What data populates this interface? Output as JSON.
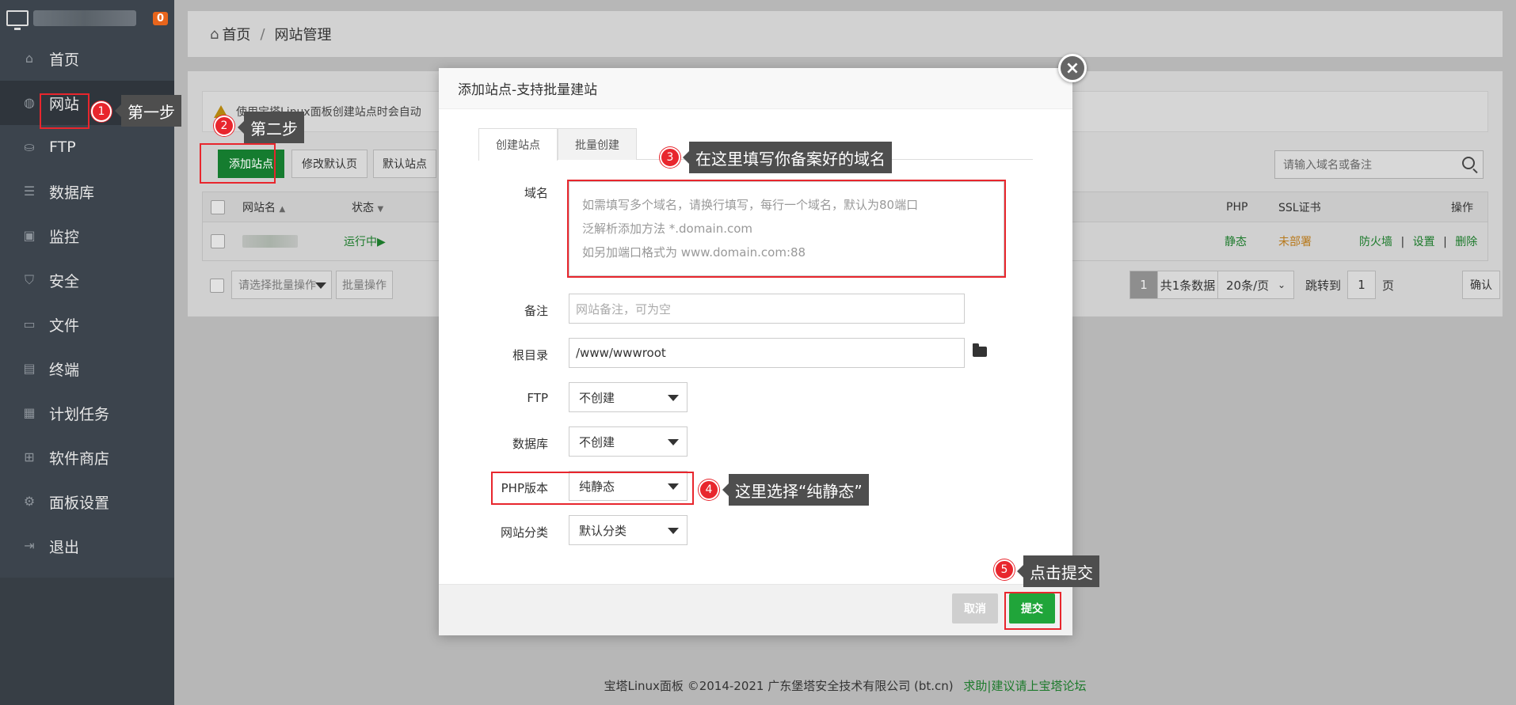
{
  "sidebar": {
    "badge_count": "0",
    "items": [
      {
        "label": "首页",
        "icon": "home-icon"
      },
      {
        "label": "网站",
        "icon": "globe-icon"
      },
      {
        "label": "FTP",
        "icon": "ftp-icon"
      },
      {
        "label": "数据库",
        "icon": "database-icon"
      },
      {
        "label": "监控",
        "icon": "monitor-icon"
      },
      {
        "label": "安全",
        "icon": "shield-icon"
      },
      {
        "label": "文件",
        "icon": "folder-icon"
      },
      {
        "label": "终端",
        "icon": "terminal-icon"
      },
      {
        "label": "计划任务",
        "icon": "calendar-icon"
      },
      {
        "label": "软件商店",
        "icon": "apps-icon"
      },
      {
        "label": "面板设置",
        "icon": "gear-icon"
      },
      {
        "label": "退出",
        "icon": "logout-icon"
      }
    ]
  },
  "breadcrumb": {
    "home": "首页",
    "current": "网站管理"
  },
  "notice": "使用宝塔Linux面板创建站点时会自动",
  "toolbar": {
    "add_site": "添加站点",
    "modify_default_page": "修改默认页",
    "default_site": "默认站点"
  },
  "search": {
    "placeholder": "请输入域名或备注"
  },
  "table": {
    "headers": {
      "name": "网站名",
      "status": "状态",
      "php": "PHP",
      "ssl": "SSL证书",
      "ops": "操作"
    },
    "row": {
      "status": "运行中▶",
      "php": "静态",
      "ssl": "未部署",
      "op_firewall": "防火墙",
      "op_settings": "设置",
      "op_delete": "删除"
    }
  },
  "batch": {
    "select_placeholder": "请选择批量操作",
    "button": "批量操作"
  },
  "pager": {
    "current": "1",
    "total": "共1条数据",
    "per_page": "20条/页",
    "jump_to": "跳转到",
    "page_input": "1",
    "page_unit": "页",
    "confirm": "确认"
  },
  "footer": {
    "copyright": "宝塔Linux面板 ©2014-2021 广东堡塔安全技术有限公司 (bt.cn)",
    "help_link": "求助|建议请上宝塔论坛"
  },
  "modal": {
    "title": "添加站点-支持批量建站",
    "close": "×",
    "tabs": [
      "创建站点",
      "批量创建"
    ],
    "labels": {
      "domain": "域名",
      "remark": "备注",
      "root": "根目录",
      "ftp": "FTP",
      "database": "数据库",
      "php": "PHP版本",
      "category": "网站分类"
    },
    "domain_placeholder": [
      "如需填写多个域名，请换行填写，每行一个域名，默认为80端口",
      "泛解析添加方法 *.domain.com",
      "如另加端口格式为 www.domain.com:88"
    ],
    "remark_placeholder": "网站备注，可为空",
    "root_value": "/www/wwwroot",
    "ftp_value": "不创建",
    "database_value": "不创建",
    "php_value": "纯静态",
    "category_value": "默认分类",
    "cancel": "取消",
    "submit": "提交"
  },
  "annotations": [
    {
      "num": "1",
      "text": "第一步"
    },
    {
      "num": "2",
      "text": "第二步"
    },
    {
      "num": "3",
      "text": "在这里填写你备案好的域名"
    },
    {
      "num": "4",
      "text": "这里选择“纯静态”"
    },
    {
      "num": "5",
      "text": "点击提交"
    }
  ],
  "colors": {
    "accent_green": "#20a53a",
    "annotation_red": "#e8262d",
    "sidebar_bg": "#3c444d"
  }
}
